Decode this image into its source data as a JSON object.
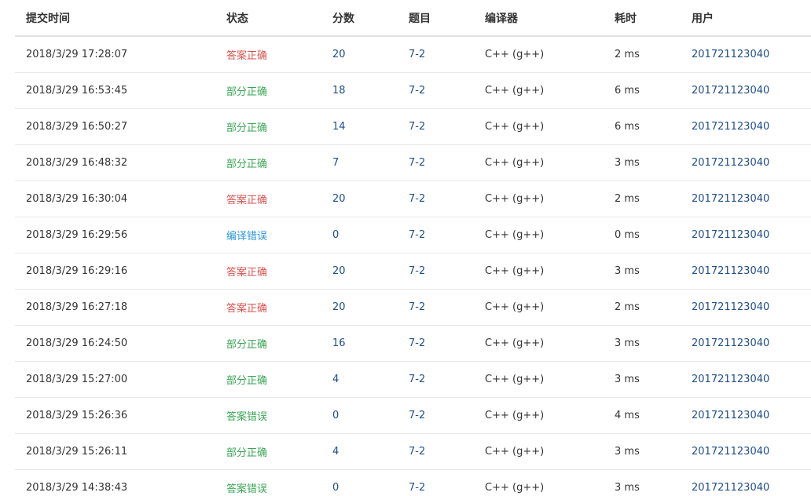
{
  "headers": {
    "time": "提交时间",
    "status": "状态",
    "score": "分数",
    "problem": "题目",
    "compiler": "编译器",
    "elapsed": "耗时",
    "user": "用户"
  },
  "status_colors": {
    "accepted": "#d9534f",
    "partial": "#3aa655",
    "compile": "#2b97d6",
    "wrong": "#3aa655"
  },
  "rows": [
    {
      "time": "2018/3/29 17:28:07",
      "status": "答案正确",
      "status_kind": "accepted",
      "score": "20",
      "problem": "7-2",
      "compiler": "C++ (g++)",
      "elapsed": "2 ms",
      "user": "201721123040"
    },
    {
      "time": "2018/3/29 16:53:45",
      "status": "部分正确",
      "status_kind": "partial",
      "score": "18",
      "problem": "7-2",
      "compiler": "C++ (g++)",
      "elapsed": "6 ms",
      "user": "201721123040"
    },
    {
      "time": "2018/3/29 16:50:27",
      "status": "部分正确",
      "status_kind": "partial",
      "score": "14",
      "problem": "7-2",
      "compiler": "C++ (g++)",
      "elapsed": "6 ms",
      "user": "201721123040"
    },
    {
      "time": "2018/3/29 16:48:32",
      "status": "部分正确",
      "status_kind": "partial",
      "score": "7",
      "problem": "7-2",
      "compiler": "C++ (g++)",
      "elapsed": "3 ms",
      "user": "201721123040"
    },
    {
      "time": "2018/3/29 16:30:04",
      "status": "答案正确",
      "status_kind": "accepted",
      "score": "20",
      "problem": "7-2",
      "compiler": "C++ (g++)",
      "elapsed": "2 ms",
      "user": "201721123040"
    },
    {
      "time": "2018/3/29 16:29:56",
      "status": "编译错误",
      "status_kind": "compile",
      "score": "0",
      "problem": "7-2",
      "compiler": "C++ (g++)",
      "elapsed": "0 ms",
      "user": "201721123040"
    },
    {
      "time": "2018/3/29 16:29:16",
      "status": "答案正确",
      "status_kind": "accepted",
      "score": "20",
      "problem": "7-2",
      "compiler": "C++ (g++)",
      "elapsed": "3 ms",
      "user": "201721123040"
    },
    {
      "time": "2018/3/29 16:27:18",
      "status": "答案正确",
      "status_kind": "accepted",
      "score": "20",
      "problem": "7-2",
      "compiler": "C++ (g++)",
      "elapsed": "2 ms",
      "user": "201721123040"
    },
    {
      "time": "2018/3/29 16:24:50",
      "status": "部分正确",
      "status_kind": "partial",
      "score": "16",
      "problem": "7-2",
      "compiler": "C++ (g++)",
      "elapsed": "3 ms",
      "user": "201721123040"
    },
    {
      "time": "2018/3/29 15:27:00",
      "status": "部分正确",
      "status_kind": "partial",
      "score": "4",
      "problem": "7-2",
      "compiler": "C++ (g++)",
      "elapsed": "3 ms",
      "user": "201721123040"
    },
    {
      "time": "2018/3/29 15:26:36",
      "status": "答案错误",
      "status_kind": "wrong",
      "score": "0",
      "problem": "7-2",
      "compiler": "C++ (g++)",
      "elapsed": "4 ms",
      "user": "201721123040"
    },
    {
      "time": "2018/3/29 15:26:11",
      "status": "部分正确",
      "status_kind": "partial",
      "score": "4",
      "problem": "7-2",
      "compiler": "C++ (g++)",
      "elapsed": "3 ms",
      "user": "201721123040"
    },
    {
      "time": "2018/3/29 14:38:43",
      "status": "答案错误",
      "status_kind": "wrong",
      "score": "0",
      "problem": "7-2",
      "compiler": "C++ (g++)",
      "elapsed": "3 ms",
      "user": "201721123040"
    }
  ]
}
